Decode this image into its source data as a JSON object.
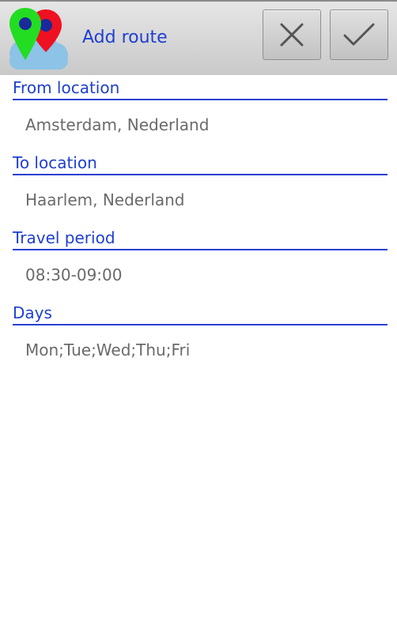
{
  "header": {
    "title": "Add route",
    "app_icon": "route-pins-cloud-icon",
    "cancel_icon": "close-icon",
    "confirm_icon": "checkmark-icon"
  },
  "form": {
    "from": {
      "label": "From location",
      "value": "Amsterdam, Nederland"
    },
    "to": {
      "label": "To location",
      "value": "Haarlem, Nederland"
    },
    "period": {
      "label": "Travel period",
      "value": "08:30-09:00"
    },
    "days": {
      "label": "Days",
      "value": "Mon;Tue;Wed;Thu;Fri"
    }
  },
  "colors": {
    "accent": "#1f3fd0",
    "value_text": "#6a6a6a",
    "pin_green": "#22dd22",
    "pin_red": "#ee1122",
    "pin_dot": "#1a2a9a",
    "cloud": "#8cc3e6"
  }
}
